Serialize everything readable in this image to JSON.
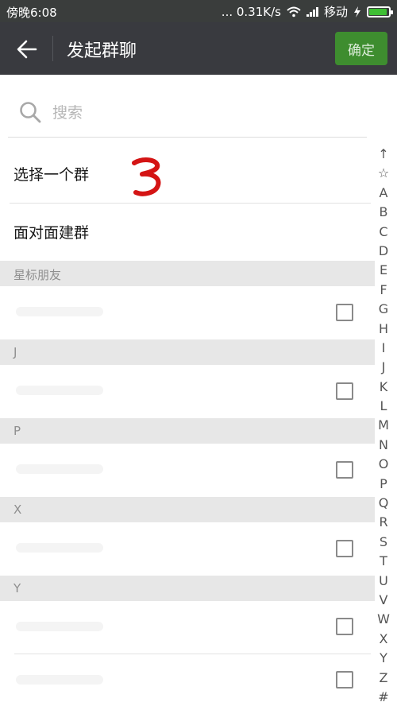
{
  "status_bar": {
    "time": "傍晚6:08",
    "speed": "... 0.31K/s",
    "carrier": "移动",
    "battery_level": 0.9
  },
  "title_bar": {
    "title": "发起群聊",
    "confirm_label": "确定"
  },
  "search": {
    "placeholder": "搜索"
  },
  "menu": {
    "select_group": "选择一个群",
    "face_to_face": "面对面建群"
  },
  "sections": [
    {
      "title": "星标朋友"
    },
    {
      "title": "J"
    },
    {
      "title": "P"
    },
    {
      "title": "X"
    },
    {
      "title": "Y"
    }
  ],
  "index": [
    "↑",
    "☆",
    "A",
    "B",
    "C",
    "D",
    "E",
    "F",
    "G",
    "H",
    "I",
    "J",
    "K",
    "L",
    "M",
    "N",
    "O",
    "P",
    "Q",
    "R",
    "S",
    "T",
    "U",
    "V",
    "W",
    "X",
    "Y",
    "Z",
    "#"
  ],
  "colors": {
    "title_bar": "#393a3f",
    "confirm": "#3e8d2f",
    "annotation": "#d41414"
  }
}
